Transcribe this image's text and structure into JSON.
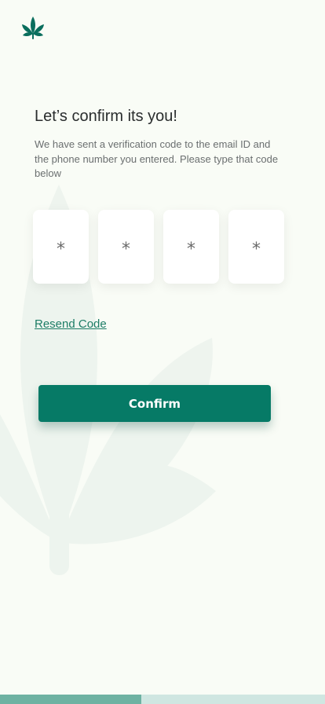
{
  "app": {
    "logo_icon": "cannabis-leaf-icon",
    "accent_color": "#067a66"
  },
  "header": {
    "title": "Let’s confirm its you!",
    "subtitle": "We have sent a verification code to the email ID and the phone number you entered. Please type that code below"
  },
  "code": {
    "digits": [
      "*",
      "*",
      "*",
      "*"
    ]
  },
  "resend": {
    "label": "Resend Code"
  },
  "confirm": {
    "label": "Confirm"
  },
  "progress": {
    "fraction": 0.435
  }
}
